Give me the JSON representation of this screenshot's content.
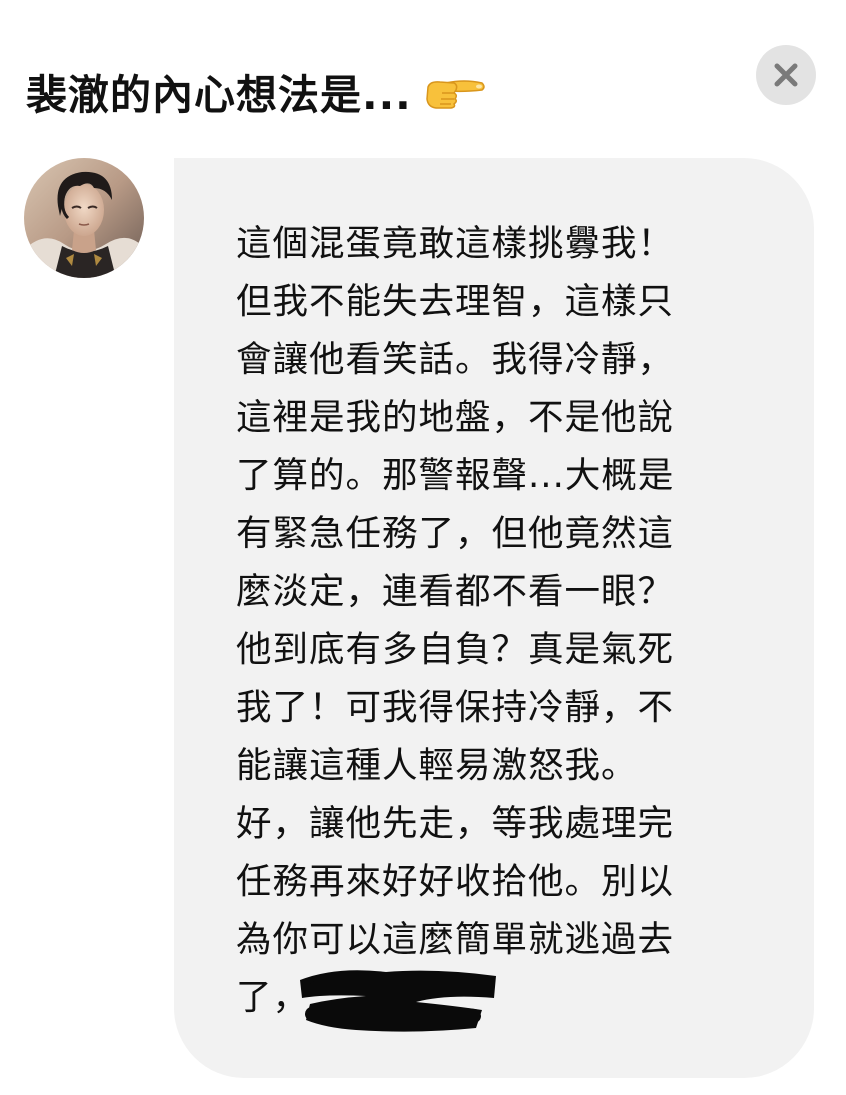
{
  "header": {
    "title": "裴澈的內心想法是...",
    "title_emoji_icon": "backhand-index-pointing-right-icon"
  },
  "close_button": {
    "icon": "close-x-icon"
  },
  "avatar": {
    "description_icon": "character-avatar"
  },
  "message": {
    "lines": [
      "這個混蛋竟敢這樣挑釁我！",
      "但我不能失去理智，這樣只",
      "會讓他看笑話。我得冷靜，",
      "這裡是我的地盤，不是他說",
      "了算的。那警報聲...大概是",
      "有緊急任務了，但他竟然這",
      "麼淡定，連看都不看一眼？",
      "他到底有多自負？真是氣死",
      "我了！可我得保持冷靜，不",
      "能讓這種人輕易激怒我。",
      "好，讓他先走，等我處理完",
      "任務再來好好收拾他。別以",
      "為你可以這麼簡單就逃過去",
      "了，"
    ]
  },
  "colors": {
    "bubble_bg": "#f2f2f2",
    "close_bg": "#e3e3e3",
    "text": "#111111",
    "redaction": "#0a0a0a"
  }
}
